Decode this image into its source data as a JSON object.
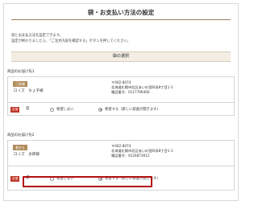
{
  "header": {
    "title": "袋・お支払い方法の設定"
  },
  "intro": {
    "line1": "袋とお支払方法を設定できます。",
    "line2": "設定が終わりましたら、「ご注文内容を確認する」ボタンを押してください。"
  },
  "section": {
    "title": "袋の選択"
  },
  "destinations": [
    {
      "label": "商品のお届け先1",
      "badge": "ご依頼",
      "name": "ロイズ　ちょ子様",
      "postal": "〒002-8074",
      "address": "北海道札幌市北区あいの里四条8丁目1-1",
      "phone": "電話番号：0117796400",
      "required_badge": "必須",
      "bag_label": "袋",
      "options": [
        "希望しない",
        "希望する（新しい袋面が開きます）"
      ],
      "selected": 1
    },
    {
      "label": "商品のお届け先2",
      "badge": "着かえ",
      "name": "ロイズ　太郎様",
      "postal": "〒002-8074",
      "address": "北海道札幌市北区あいの里四条8丁目1-1",
      "phone": "電話番号：0120873612",
      "required_badge": "必須",
      "bag_label": "袋",
      "options": [
        "希望しない",
        "希望する（新しい袋面が開きます）"
      ],
      "selected": 1
    }
  ],
  "colors": {
    "accent": "#b08a5a",
    "required": "#c0392b",
    "highlight": "#b40f12"
  }
}
